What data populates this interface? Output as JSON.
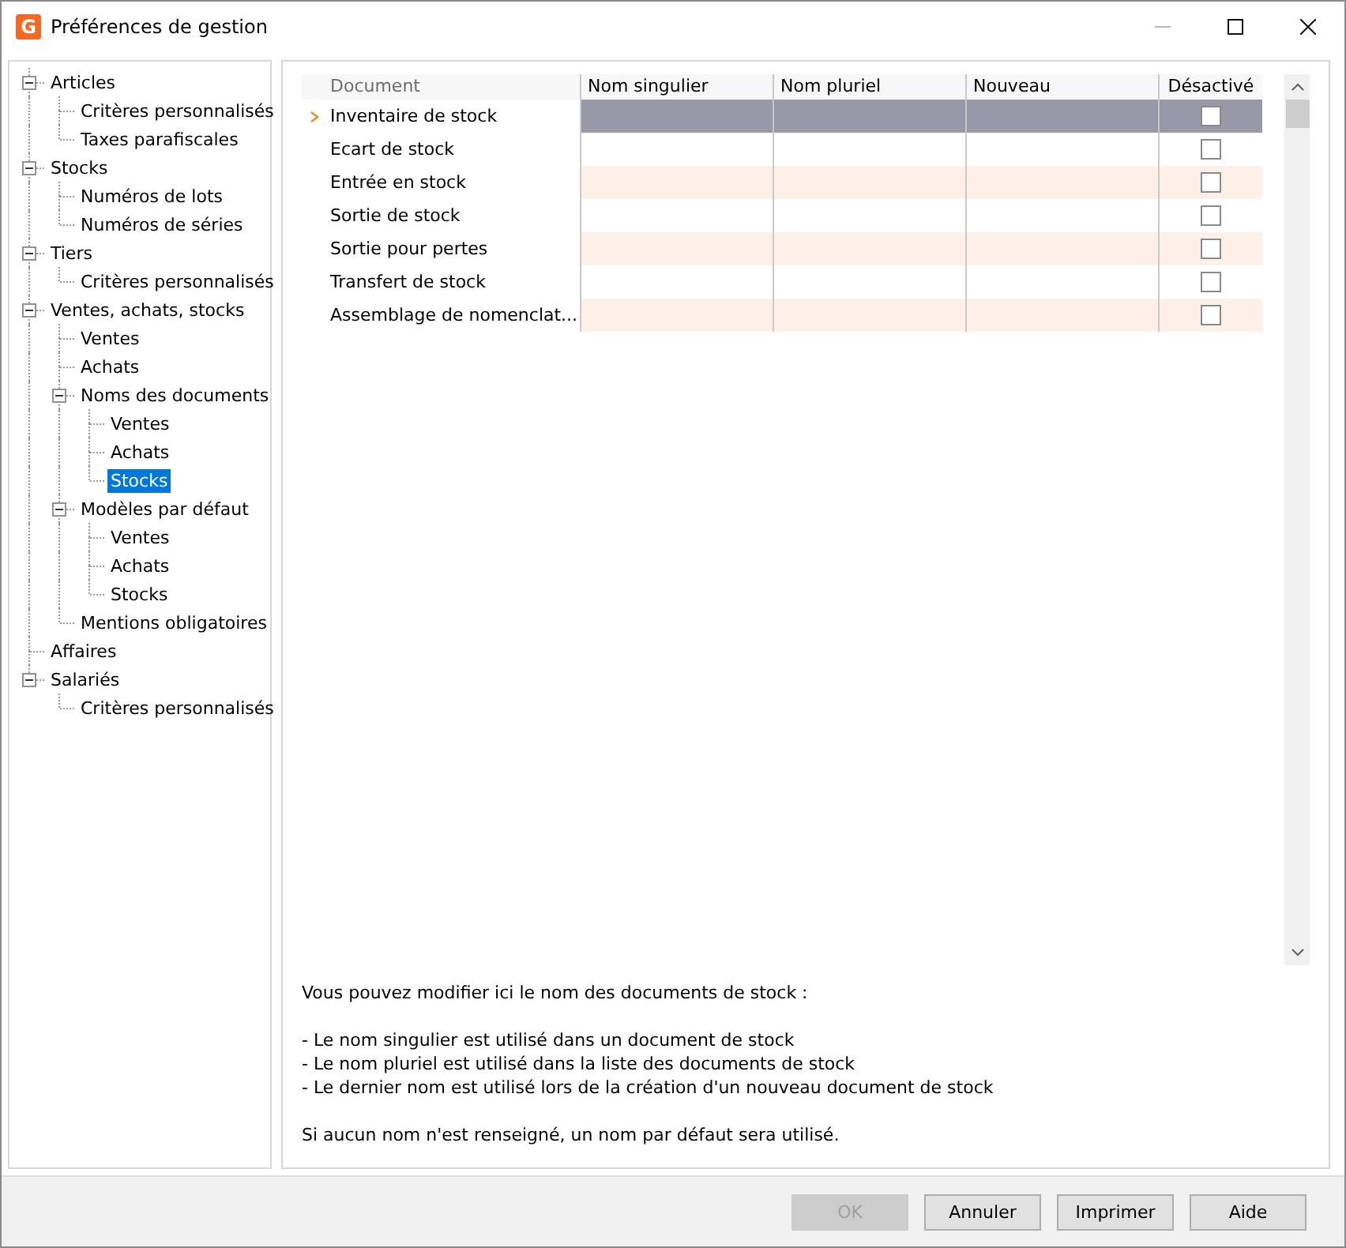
{
  "window": {
    "title": "Préférences de gestion",
    "icon_letter": "G",
    "minimize_disabled": true
  },
  "tree": [
    {
      "label": "Articles",
      "expanded": true,
      "selected": false,
      "children": [
        {
          "label": "Critères personnalisés",
          "selected": false
        },
        {
          "label": "Taxes parafiscales",
          "selected": false
        }
      ]
    },
    {
      "label": "Stocks",
      "expanded": true,
      "selected": false,
      "children": [
        {
          "label": "Numéros de lots",
          "selected": false
        },
        {
          "label": "Numéros de séries",
          "selected": false
        }
      ]
    },
    {
      "label": "Tiers",
      "expanded": true,
      "selected": false,
      "children": [
        {
          "label": "Critères personnalisés",
          "selected": false
        }
      ]
    },
    {
      "label": "Ventes, achats, stocks",
      "expanded": true,
      "selected": false,
      "children": [
        {
          "label": "Ventes",
          "selected": false
        },
        {
          "label": "Achats",
          "selected": false
        },
        {
          "label": "Noms des documents",
          "expanded": true,
          "selected": false,
          "children": [
            {
              "label": "Ventes",
              "selected": false
            },
            {
              "label": "Achats",
              "selected": false
            },
            {
              "label": "Stocks",
              "selected": true
            }
          ]
        },
        {
          "label": "Modèles par défaut",
          "expanded": true,
          "selected": false,
          "children": [
            {
              "label": "Ventes",
              "selected": false
            },
            {
              "label": "Achats",
              "selected": false
            },
            {
              "label": "Stocks",
              "selected": false
            }
          ]
        },
        {
          "label": "Mentions obligatoires",
          "selected": false
        }
      ]
    },
    {
      "label": "Affaires",
      "selected": false
    },
    {
      "label": "Salariés",
      "expanded": true,
      "selected": false,
      "children": [
        {
          "label": "Critères personnalisés",
          "selected": false
        }
      ]
    }
  ],
  "table": {
    "columns": [
      "Document",
      "Nom singulier",
      "Nom pluriel",
      "Nouveau",
      "Désactivé"
    ],
    "rows": [
      {
        "document": "Inventaire de stock",
        "selected": true,
        "checked": false
      },
      {
        "document": "Ecart de stock",
        "selected": false,
        "checked": false
      },
      {
        "document": "Entrée en stock",
        "selected": false,
        "checked": false
      },
      {
        "document": "Sortie de stock",
        "selected": false,
        "checked": false
      },
      {
        "document": "Sortie pour pertes",
        "selected": false,
        "checked": false
      },
      {
        "document": "Transfert de stock",
        "selected": false,
        "checked": false
      },
      {
        "document": "Assemblage de nomenclat...",
        "selected": false,
        "checked": false
      }
    ]
  },
  "description": {
    "intro": "Vous pouvez modifier ici le nom des documents de stock :",
    "bullets": [
      "- Le nom singulier est utilisé dans un document de stock",
      "- Le nom pluriel est utilisé dans la liste des documents de stock",
      "- Le dernier nom est utilisé lors de la création d'un nouveau document de stock"
    ],
    "footer": "Si aucun nom n'est renseigné, un nom par défaut sera utilisé."
  },
  "buttons": [
    {
      "label": "OK",
      "disabled": true
    },
    {
      "label": "Annuler",
      "disabled": false
    },
    {
      "label": "Imprimer",
      "disabled": false
    },
    {
      "label": "Aide",
      "disabled": false
    }
  ]
}
